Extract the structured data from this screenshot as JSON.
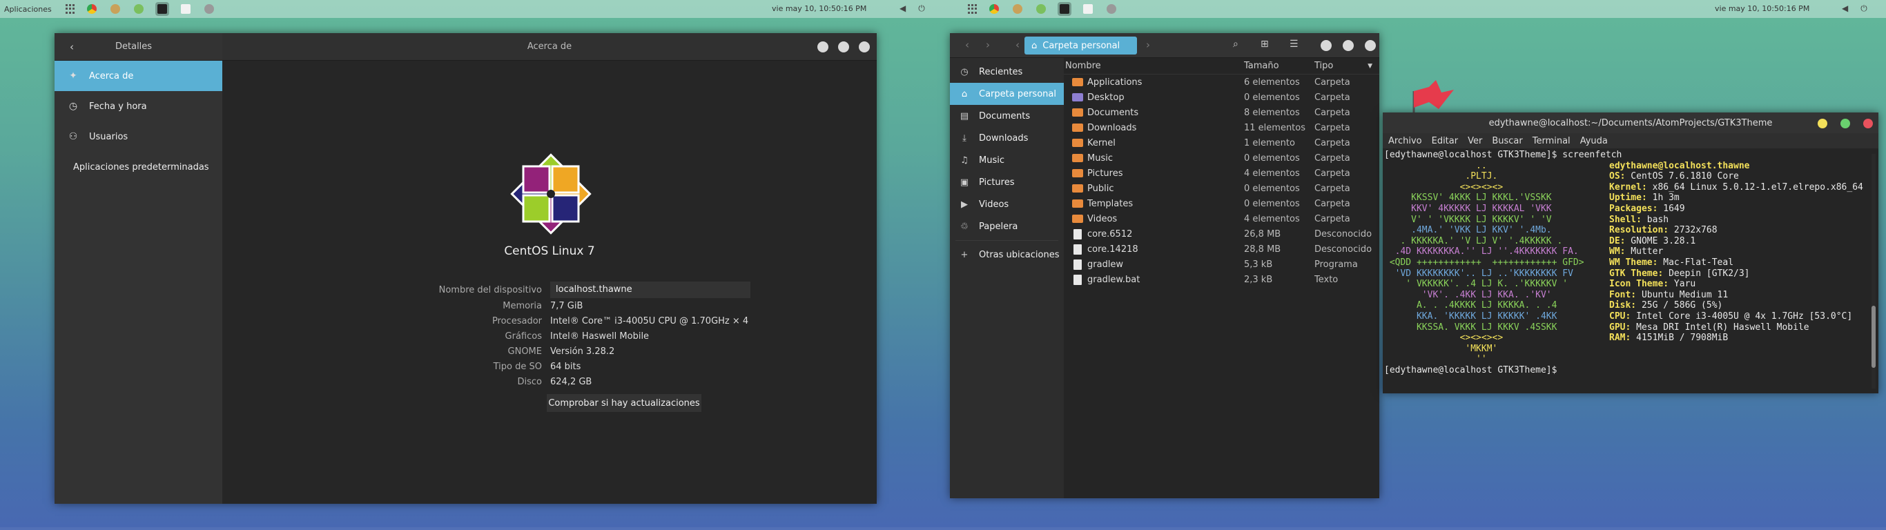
{
  "panel_left": {
    "apps_label": "Aplicaciones",
    "clock": "vie may 10, 10:50:16 PM"
  },
  "panel_right": {
    "clock": "vie may 10, 10:50:16 PM"
  },
  "settings": {
    "sidebar_title": "Detalles",
    "header_title": "Acerca de",
    "items": [
      {
        "label": "Acerca de",
        "icon": "sparkle-icon"
      },
      {
        "label": "Fecha y hora",
        "icon": "clock-icon"
      },
      {
        "label": "Usuarios",
        "icon": "user-icon"
      },
      {
        "label": "Aplicaciones predeterminadas",
        "icon": ""
      }
    ],
    "os_name": "CentOS Linux 7",
    "device_label": "Nombre del dispositivo",
    "device_value": "localhost.thawne",
    "rows": [
      {
        "k": "Memoria",
        "v": "7,7 GiB"
      },
      {
        "k": "Procesador",
        "v": "Intel® Core™ i3-4005U CPU @ 1.70GHz × 4"
      },
      {
        "k": "Gráficos",
        "v": "Intel® Haswell Mobile"
      },
      {
        "k": "GNOME",
        "v": "Versión 3.28.2"
      },
      {
        "k": "Tipo de SO",
        "v": "64 bits"
      },
      {
        "k": "Disco",
        "v": "624,2 GB"
      }
    ],
    "update_button": "Comprobar si hay actualizaciones"
  },
  "files": {
    "location": "Carpeta personal",
    "sidebar": [
      {
        "label": "Recientes",
        "icon": "clock-icon"
      },
      {
        "label": "Carpeta personal",
        "icon": "home-icon"
      },
      {
        "label": "Documents",
        "icon": "document-icon"
      },
      {
        "label": "Downloads",
        "icon": "download-icon"
      },
      {
        "label": "Music",
        "icon": "music-icon"
      },
      {
        "label": "Pictures",
        "icon": "picture-icon"
      },
      {
        "label": "Videos",
        "icon": "video-icon"
      },
      {
        "label": "Papelera",
        "icon": "trash-icon"
      },
      {
        "label": "Otras ubicaciones",
        "icon": "plus-icon"
      }
    ],
    "columns": {
      "name": "Nombre",
      "size": "Tamaño",
      "type": "Tipo"
    },
    "rows": [
      {
        "name": "Applications",
        "size": "6 elementos",
        "type": "Carpeta",
        "folder": true
      },
      {
        "name": "Desktop",
        "size": "0 elementos",
        "type": "Carpeta",
        "folder": true
      },
      {
        "name": "Documents",
        "size": "8 elementos",
        "type": "Carpeta",
        "folder": true
      },
      {
        "name": "Downloads",
        "size": "11 elementos",
        "type": "Carpeta",
        "folder": true
      },
      {
        "name": "Kernel",
        "size": "1 elemento",
        "type": "Carpeta",
        "folder": true
      },
      {
        "name": "Music",
        "size": "0 elementos",
        "type": "Carpeta",
        "folder": true
      },
      {
        "name": "Pictures",
        "size": "4 elementos",
        "type": "Carpeta",
        "folder": true
      },
      {
        "name": "Public",
        "size": "0 elementos",
        "type": "Carpeta",
        "folder": true
      },
      {
        "name": "Templates",
        "size": "0 elementos",
        "type": "Carpeta",
        "folder": true
      },
      {
        "name": "Videos",
        "size": "4 elementos",
        "type": "Carpeta",
        "folder": true
      },
      {
        "name": "core.6512",
        "size": "26,8 MB",
        "type": "Desconocido",
        "folder": false
      },
      {
        "name": "core.14218",
        "size": "28,8 MB",
        "type": "Desconocido",
        "folder": false
      },
      {
        "name": "gradlew",
        "size": "5,3 kB",
        "type": "Programa",
        "folder": false
      },
      {
        "name": "gradlew.bat",
        "size": "2,3 kB",
        "type": "Texto",
        "folder": false
      }
    ]
  },
  "terminal": {
    "title": "edythawne@localhost:~/Documents/AtomProjects/GTK3Theme",
    "menu": [
      "Archivo",
      "Editar",
      "Ver",
      "Buscar",
      "Terminal",
      "Ayuda"
    ],
    "prompt1": "[edythawne@localhost GTK3Theme]$ screenfetch",
    "logo": [
      "                 ..",
      "               .PLTJ.",
      "              <><><><>",
      "     KKSSV' 4KKK LJ KKKL.'VSSKK",
      "     KKV' 4KKKKK LJ KKKKAL 'VKK",
      "     V' ' 'VKKKK LJ KKKKV' ' 'V",
      "     .4MA.' 'VKK LJ KKV' '.4Mb.",
      "   . KKKKKA.' 'V LJ V' '.4KKKKK .",
      "  .4D KKKKKKKA.'' LJ ''.4KKKKKKK FA.",
      " <QDD ++++++++++++  ++++++++++++ GFD>",
      "  'VD KKKKKKKK'.. LJ ..'KKKKKKKK FV",
      "    ' VKKKKK'. .4 LJ K. .'KKKKKV '",
      "       'VK'. .4KK LJ KKA. .'KV'",
      "      A. . .4KKKK LJ KKKKA. . .4",
      "      KKA. 'KKKKK LJ KKKKK' .4KK",
      "      KKSSA. VKKK LJ KKKV .4SSKK",
      "              <><><><>",
      "               'MKKM'",
      "                 ''"
    ],
    "info_user": "edythawne@localhost.thawne",
    "info": [
      {
        "k": "OS:",
        "v": "CentOS 7.6.1810 Core"
      },
      {
        "k": "Kernel:",
        "v": "x86_64 Linux 5.0.12-1.el7.elrepo.x86_64"
      },
      {
        "k": "Uptime:",
        "v": "1h 3m"
      },
      {
        "k": "Packages:",
        "v": "1649"
      },
      {
        "k": "Shell:",
        "v": "bash"
      },
      {
        "k": "Resolution:",
        "v": "2732x768"
      },
      {
        "k": "DE:",
        "v": "GNOME 3.28.1"
      },
      {
        "k": "WM:",
        "v": "Mutter"
      },
      {
        "k": "WM Theme:",
        "v": "Mac-Flat-Teal"
      },
      {
        "k": "GTK Theme:",
        "v": "Deepin [GTK2/3]"
      },
      {
        "k": "Icon Theme:",
        "v": "Yaru"
      },
      {
        "k": "Font:",
        "v": "Ubuntu Medium 11"
      },
      {
        "k": "Disk:",
        "v": "25G / 586G (5%)"
      },
      {
        "k": "CPU:",
        "v": "Intel Core i3-4005U @ 4x 1.7GHz [53.0°C]"
      },
      {
        "k": "GPU:",
        "v": "Mesa DRI Intel(R) Haswell Mobile"
      },
      {
        "k": "RAM:",
        "v": "4151MiB / 7908MiB"
      }
    ],
    "prompt2": "[edythawne@localhost GTK3Theme]$"
  },
  "colors": {
    "accent": "#5ab0d4",
    "folder": "#e88a3c",
    "term_yellow": "#f3e05a",
    "term_green": "#8ad25a",
    "term_purple": "#c67fd1",
    "term_blue": "#6fa8dc"
  }
}
